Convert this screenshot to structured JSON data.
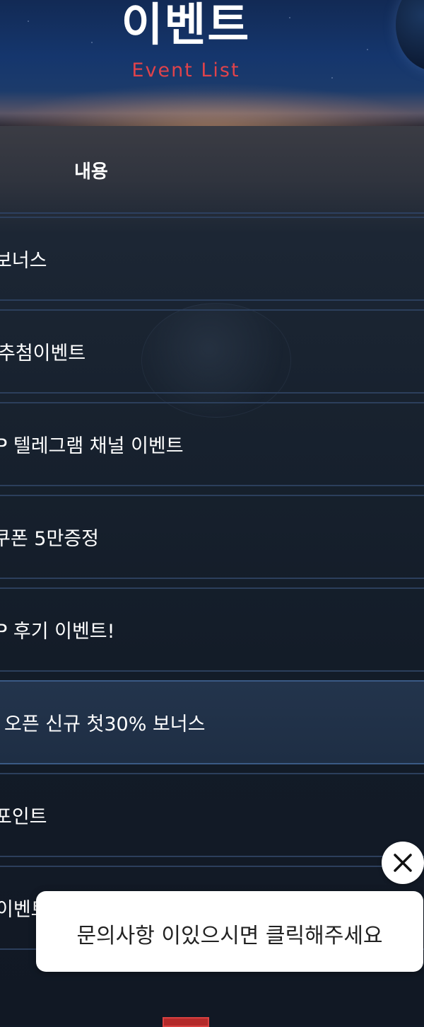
{
  "header": {
    "title": "이벤트",
    "subtitle": "Event List"
  },
  "table": {
    "column_header": "내용",
    "rows": [
      {
        "label": "보너스"
      },
      {
        "label": "추첨이벤트"
      },
      {
        "label": "P 텔레그램 채널 이벤트"
      },
      {
        "label": "쿠폰 5만증정"
      },
      {
        "label": "P 후기 이벤트!"
      },
      {
        "label": "오픈 신규 첫30% 보너스"
      },
      {
        "label": "포인트"
      },
      {
        "label": "이벤트"
      }
    ],
    "active_row_index": 5
  },
  "chat": {
    "message": "문의사항 이있으시면 클릭해주세요",
    "close_icon": "close-icon"
  },
  "colors": {
    "accent": "#e0434b",
    "background": "#111a27",
    "row_border": "#2c3f5c"
  }
}
